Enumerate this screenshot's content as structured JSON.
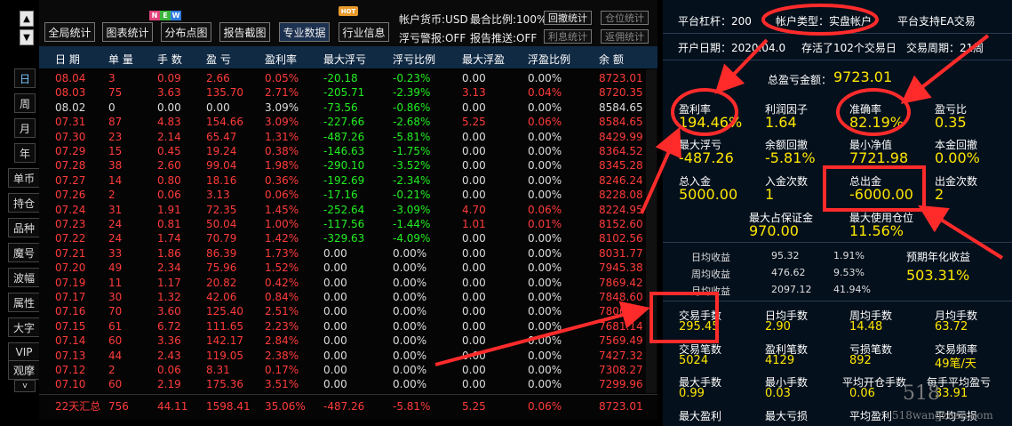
{
  "nav": {
    "up": "▲",
    "down": "▼"
  },
  "side_tabs": [
    "日",
    "周",
    "月",
    "年",
    "单币",
    "持仓",
    "品种",
    "魔号",
    "波幅",
    "属性",
    "大字",
    "VIP",
    "观摩"
  ],
  "side_tab_selected": 0,
  "side_scroll": "v",
  "toolbar": {
    "buttons": [
      "全局统计",
      "图表统计",
      "分布点图",
      "报告截图",
      "专业数据",
      "行业信息"
    ],
    "active": 4,
    "new_badge": [
      "N",
      "E",
      "W"
    ],
    "hot_badge": "HOT",
    "account_currency": "帐户货币:USD",
    "max_ratio": "最合比例:100%",
    "float_warning": "浮亏警报:OFF",
    "report_push": "报告推送:OFF",
    "btn_withdraw_stats": "回撤统计",
    "btn_position_stats": "仓位统计",
    "btn_interest_stats": "利息统计",
    "btn_return_stats": "返佣统计"
  },
  "table": {
    "headers": [
      "日 期",
      "单 量",
      "手 数",
      "盈 亏",
      "盈利率",
      "最大浮亏",
      "浮亏比例",
      "最大浮盈",
      "浮盈比例",
      "余 额"
    ],
    "rows": [
      [
        "08.04",
        "3",
        "0.09",
        "2.66",
        "0.05%",
        "-20.18",
        "-0.23%",
        "0.00",
        "0.00%",
        "8723.01"
      ],
      [
        "08.03",
        "75",
        "3.63",
        "135.70",
        "2.71%",
        "-205.71",
        "-2.39%",
        "3.13",
        "0.04%",
        "8720.35"
      ],
      [
        "08.02",
        "0",
        "0.00",
        "0.00",
        "3.09%",
        "-73.56",
        "-0.86%",
        "0.00",
        "0.00%",
        "8584.65"
      ],
      [
        "07.31",
        "87",
        "4.83",
        "154.66",
        "3.09%",
        "-227.66",
        "-2.68%",
        "5.25",
        "0.06%",
        "8584.65"
      ],
      [
        "07.30",
        "23",
        "2.14",
        "65.47",
        "1.31%",
        "-487.26",
        "-5.81%",
        "0.00",
        "0.00%",
        "8429.99"
      ],
      [
        "07.29",
        "15",
        "0.45",
        "19.24",
        "0.38%",
        "-146.63",
        "-1.75%",
        "0.00",
        "0.00%",
        "8364.52"
      ],
      [
        "07.28",
        "38",
        "2.60",
        "99.04",
        "1.98%",
        "-290.10",
        "-3.52%",
        "0.00",
        "0.00%",
        "8345.28"
      ],
      [
        "07.27",
        "14",
        "0.80",
        "18.16",
        "0.36%",
        "-192.69",
        "-2.34%",
        "0.00",
        "0.00%",
        "8246.24"
      ],
      [
        "07.26",
        "2",
        "0.06",
        "3.13",
        "0.06%",
        "-17.16",
        "-0.21%",
        "0.00",
        "0.00%",
        "8228.08"
      ],
      [
        "07.24",
        "31",
        "1.91",
        "72.35",
        "1.45%",
        "-252.64",
        "-3.09%",
        "4.70",
        "0.06%",
        "8224.95"
      ],
      [
        "07.23",
        "24",
        "0.81",
        "50.04",
        "1.00%",
        "-117.56",
        "-1.44%",
        "1.01",
        "0.01%",
        "8152.60"
      ],
      [
        "07.22",
        "24",
        "1.74",
        "70.79",
        "1.42%",
        "-329.63",
        "-4.09%",
        "0.00",
        "0.00%",
        "8102.56"
      ],
      [
        "07.21",
        "33",
        "1.86",
        "86.39",
        "1.73%",
        "0.00",
        "0.00%",
        "0.00",
        "0.00%",
        "8031.77"
      ],
      [
        "07.20",
        "49",
        "2.34",
        "75.96",
        "1.52%",
        "0.00",
        "0.00%",
        "0.00",
        "0.00%",
        "7945.38"
      ],
      [
        "07.19",
        "11",
        "1.17",
        "20.82",
        "0.42%",
        "0.00",
        "0.00%",
        "0.00",
        "0.00%",
        "7869.42"
      ],
      [
        "07.17",
        "30",
        "1.32",
        "42.06",
        "0.84%",
        "0.00",
        "0.00%",
        "0.00",
        "0.00%",
        "7848.60"
      ],
      [
        "07.16",
        "70",
        "3.60",
        "125.40",
        "2.51%",
        "0.00",
        "0.00%",
        "0.00",
        "0.00%",
        "7806.54"
      ],
      [
        "07.15",
        "61",
        "6.72",
        "111.65",
        "2.23%",
        "0.00",
        "0.00%",
        "0.00",
        "0.00%",
        "7681.14"
      ],
      [
        "07.14",
        "60",
        "3.36",
        "142.17",
        "2.84%",
        "0.00",
        "0.00%",
        "0.00",
        "0.00%",
        "7569.49"
      ],
      [
        "07.13",
        "44",
        "2.43",
        "119.05",
        "2.38%",
        "0.00",
        "0.00%",
        "0.00",
        "0.00%",
        "7427.32"
      ],
      [
        "07.12",
        "2",
        "0.06",
        "8.31",
        "0.17%",
        "0.00",
        "0.00%",
        "0.00",
        "0.00%",
        "7308.27"
      ],
      [
        "07.10",
        "60",
        "2.19",
        "175.36",
        "3.51%",
        "0.00",
        "0.00%",
        "0.00",
        "0.00%",
        "7299.96"
      ]
    ],
    "summary": [
      "22天汇总",
      "756",
      "44.11",
      "1598.41",
      "35.06%",
      "-487.26",
      "-5.81%",
      "5.25",
      "0.06%",
      "8723.01"
    ]
  },
  "stats": {
    "leverage": "平台杠杆：200",
    "account_type": "帐户类型：实盘帐户",
    "ea_support": "平台支持EA交易",
    "open_date": "开户日期：2020.04.0",
    "survived": "存活了102个交易日",
    "trade_cycle": "交易周期：21周",
    "total_pl_label": "总盈亏金额：",
    "total_pl_value": "9723.01",
    "profit_rate_label": "盈利率",
    "profit_rate": "194.46%",
    "profit_factor_label": "利润因子",
    "profit_factor": "1.64",
    "accuracy_label": "准确率",
    "accuracy": "82.19%",
    "pl_ratio_label": "盈亏比",
    "pl_ratio": "0.35",
    "max_float_loss_label": "最大浮亏",
    "max_float_loss": "-487.26",
    "balance_drawdown_label": "余额回撤",
    "balance_drawdown": "-5.81%",
    "min_net_label": "最小净值",
    "min_net": "7721.98",
    "principal_drawdown_label": "本金回撤",
    "principal_drawdown": "0.00%",
    "total_deposit_label": "总入金",
    "total_deposit": "5000.00",
    "deposit_count_label": "入金次数",
    "deposit_count": "1",
    "total_withdraw_label": "总出金",
    "total_withdraw": "-6000.00",
    "withdraw_count_label": "出金次数",
    "withdraw_count": "2",
    "max_margin_label": "最大占保证金",
    "max_margin": "970.00",
    "max_position_label": "最大使用仓位",
    "max_position": "11.56%",
    "daily_return_label": "日均收益",
    "daily_return": "95.32",
    "daily_return_pct": "1.91%",
    "weekly_return_label": "周均收益",
    "weekly_return": "476.62",
    "weekly_return_pct": "9.53%",
    "monthly_return_label": "月均收益",
    "monthly_return": "2097.12",
    "monthly_return_pct": "41.94%",
    "annual_label": "预期年化收益",
    "annual_value": "503.31%",
    "lots_label": "交易手数",
    "lots": "295.45",
    "daily_lots_label": "日均手数",
    "daily_lots": "2.90",
    "weekly_lots_label": "周均手数",
    "weekly_lots": "14.48",
    "monthly_lots_label": "月均手数",
    "monthly_lots": "63.72",
    "trades_label": "交易笔数",
    "trades": "5024",
    "win_trades_label": "盈利笔数",
    "win_trades": "4129",
    "loss_trades_label": "亏损笔数",
    "loss_trades": "892",
    "frequency_label": "交易频率",
    "frequency": "49笔/天",
    "max_lots_label": "最大手数",
    "max_lots": "0.99",
    "min_lots_label": "最小手数",
    "min_lots": "0.03",
    "avg_open_label": "平均开仓手数",
    "avg_open": "0.06",
    "avg_pl_per_lot_label": "每手平均盈亏",
    "avg_pl_per_lot": "33.91",
    "max_profit_label": "最大盈利",
    "max_loss_label": "最大亏损",
    "avg_profit_label": "平均盈利",
    "avg_loss_label": "平均亏损"
  },
  "watermark": {
    "line1": "518",
    "line2": "518wangzhan.com"
  },
  "colors": {
    "accent": "#ff3333",
    "value": "#ffe600",
    "header_bg": "#102a44",
    "panel_bg": "#04101c"
  }
}
